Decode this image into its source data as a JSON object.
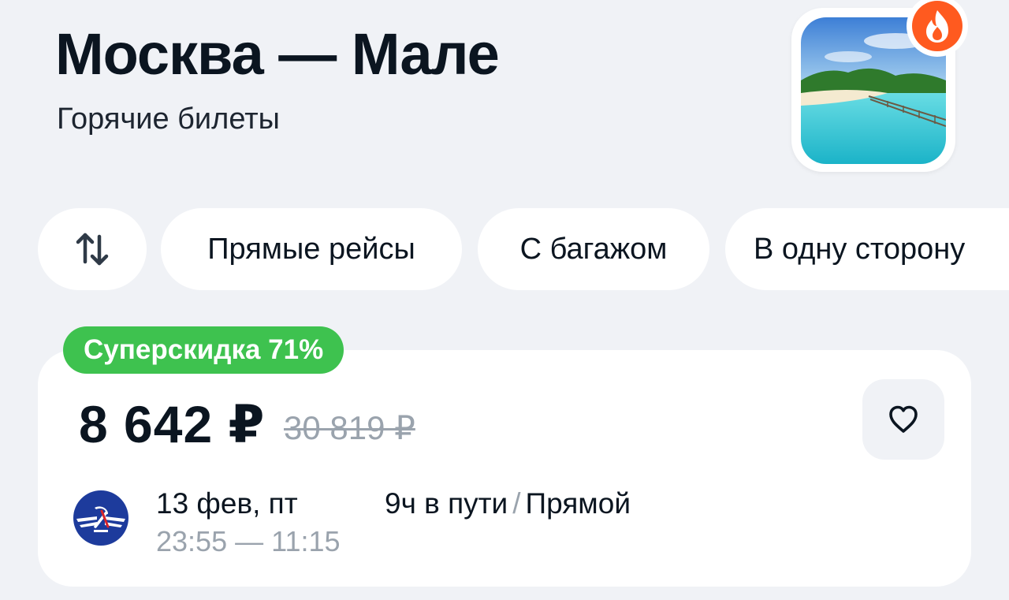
{
  "header": {
    "title": "Москва — Мале",
    "subtitle": "Горячие билеты"
  },
  "thumbnail": {
    "image": "beach-island-photo",
    "badge_icon": "fire-icon"
  },
  "filters": {
    "sort_icon": "sort-arrows-icon",
    "chips": [
      "Прямые рейсы",
      "С багажом",
      "В одну сторону"
    ]
  },
  "offer": {
    "discount_label": "Суперскидка 71%",
    "price": "8 642 ₽",
    "old_price": "30 819 ₽",
    "favorite_icon": "heart-icon",
    "airline_logo": "aeroflot-logo",
    "date": "13 фев, пт",
    "time_range": "23:55 — 11:15",
    "duration": "9ч в пути",
    "route_type": "Прямой",
    "separator": "/"
  },
  "colors": {
    "background": "#f0f2f6",
    "discount_green": "#3ec24f",
    "fire_orange": "#ff5a1f",
    "muted_text": "#9aa3ad",
    "airline_blue": "#1d3b9c"
  }
}
